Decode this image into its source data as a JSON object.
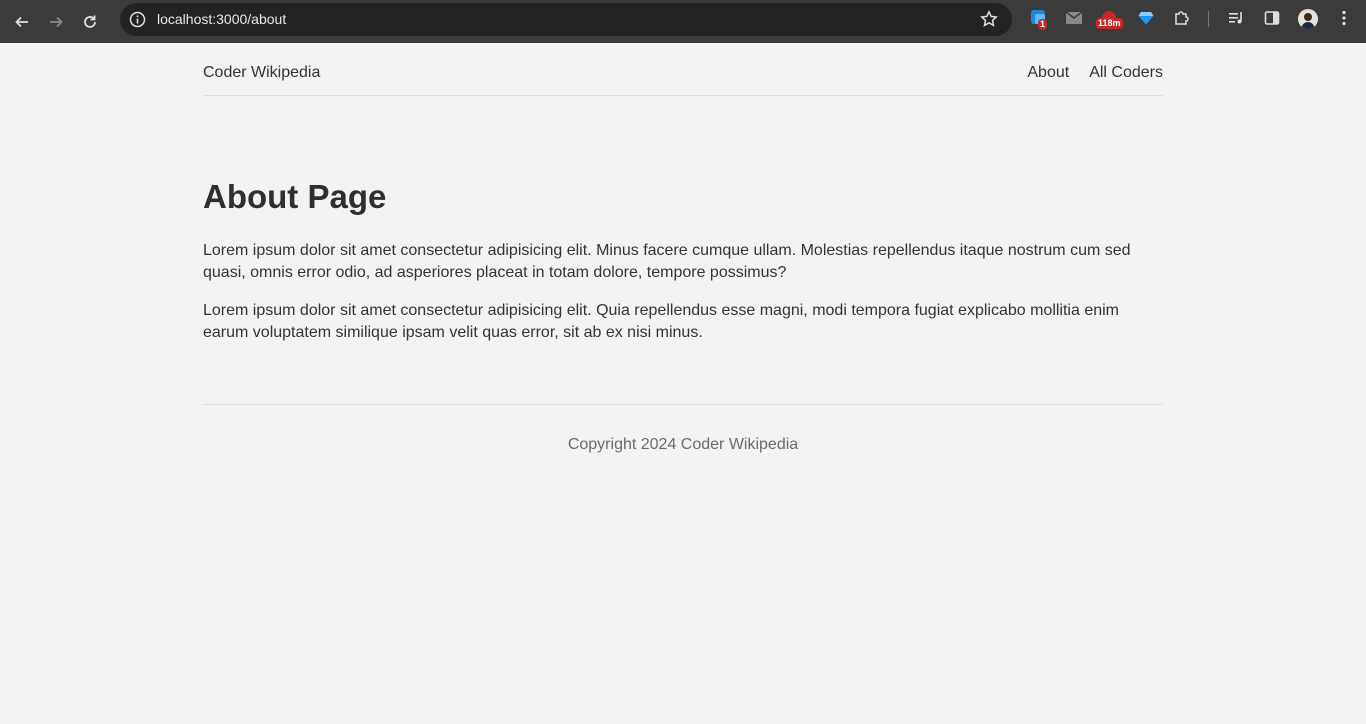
{
  "browser": {
    "url": "localhost:3000/about",
    "extensions": [
      {
        "name": "translate-extension",
        "badge": "1",
        "badge_color": "#d32f2f"
      },
      {
        "name": "mail-extension"
      },
      {
        "name": "timer-extension",
        "badge": "118m",
        "badge_color": "#b71c1c"
      },
      {
        "name": "gem-extension"
      },
      {
        "name": "puzzle-extension"
      }
    ]
  },
  "site": {
    "brand": "Coder Wikipedia",
    "nav": [
      {
        "label": "About"
      },
      {
        "label": "All Coders"
      }
    ]
  },
  "main": {
    "title": "About Page",
    "paragraphs": [
      "Lorem ipsum dolor sit amet consectetur adipisicing elit. Minus facere cumque ullam. Molestias repellendus itaque nostrum cum sed quasi, omnis error odio, ad asperiores placeat in totam dolore, tempore possimus?",
      "Lorem ipsum dolor sit amet consectetur adipisicing elit. Quia repellendus esse magni, modi tempora fugiat explicabo mollitia enim earum voluptatem similique ipsam velit quas error, sit ab ex nisi minus."
    ]
  },
  "footer": {
    "copyright": "Copyright 2024 Coder Wikipedia"
  },
  "colors": {
    "chrome_bg": "#3b3b3b",
    "omnibox_bg": "#232323",
    "page_bg": "#f3f3f3",
    "text": "#333333"
  }
}
